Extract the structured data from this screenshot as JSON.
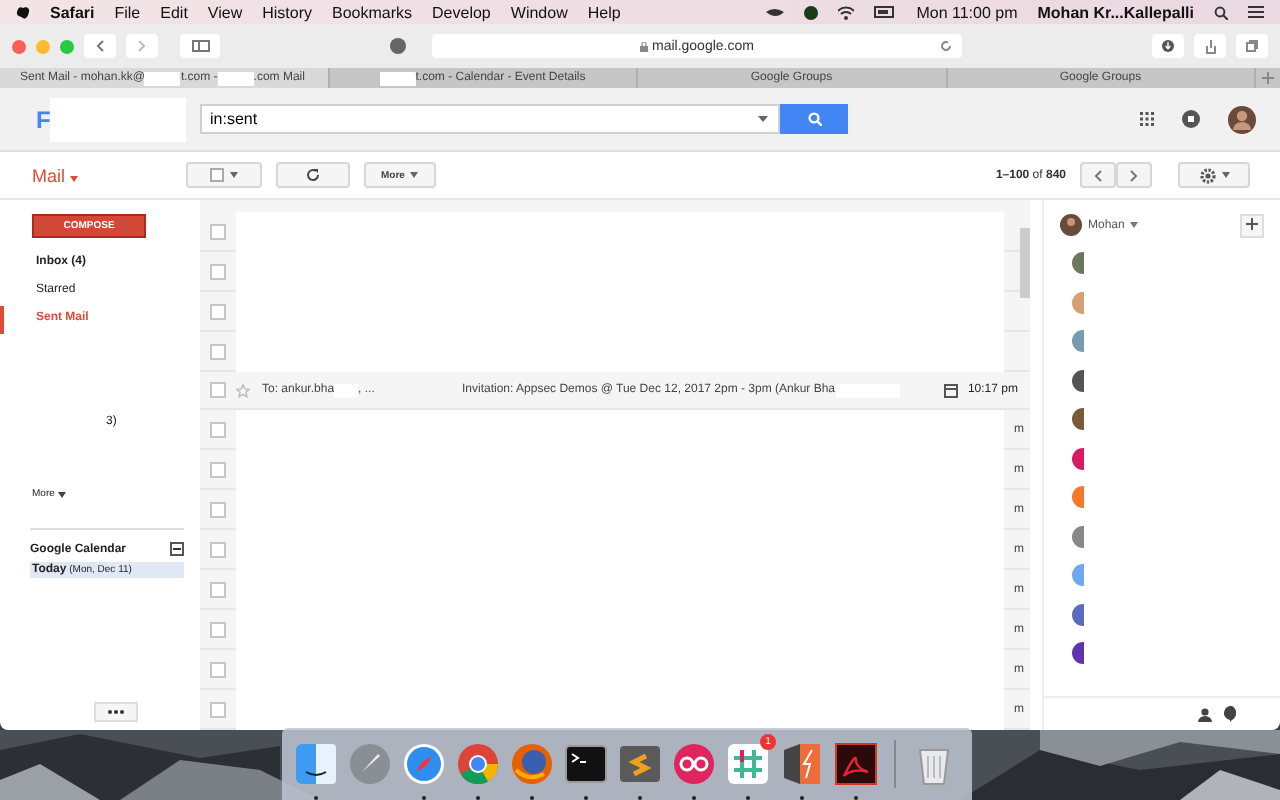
{
  "menubar": {
    "app": "Safari",
    "menus": [
      "File",
      "Edit",
      "View",
      "History",
      "Bookmarks",
      "Develop",
      "Window",
      "Help"
    ],
    "clock": "Mon 11:00 pm",
    "user": "Mohan Kr...Kallepalli"
  },
  "browser": {
    "address": "mail.google.com",
    "tabs": [
      {
        "selected": true,
        "segments": [
          {
            "kind": "text",
            "text": "Sent Mail - mohan.kk@"
          },
          {
            "kind": "redacted"
          },
          {
            "kind": "text",
            "text": "t.com -"
          },
          {
            "kind": "redacted"
          },
          {
            "kind": "text",
            "text": ".com Mail"
          }
        ]
      },
      {
        "selected": false,
        "segments": [
          {
            "kind": "redacted"
          },
          {
            "kind": "text",
            "text": "t.com - Calendar - Event Details"
          }
        ]
      },
      {
        "selected": false,
        "segments": [
          {
            "kind": "text",
            "text": "Google Groups"
          }
        ]
      },
      {
        "selected": false,
        "segments": [
          {
            "kind": "text",
            "text": "Google Groups"
          }
        ]
      }
    ]
  },
  "gmail": {
    "logo_letter": "F",
    "search": {
      "value": "in:sent"
    },
    "mail_label": "Mail",
    "more_button": "More",
    "pager": "**1–100** of **840**"
  },
  "sidebar": {
    "compose": "COMPOSE",
    "items": [
      {
        "label": "Inbox (4)",
        "bold": true,
        "selected": false
      },
      {
        "label": "Starred",
        "bold": false,
        "selected": false
      },
      {
        "label": "Sent Mail",
        "bold": true,
        "selected": true
      }
    ],
    "fragment": "3)",
    "more": "More",
    "calendar": {
      "title": "Google Calendar",
      "expanded": true,
      "today": "Today",
      "date": "(Mon, Dec 11)"
    }
  },
  "rows": [
    {
      "kind": "redacted",
      "checked": false
    },
    {
      "kind": "redacted",
      "checked": false
    },
    {
      "kind": "redacted",
      "checked": false
    },
    {
      "kind": "redacted",
      "checked": false
    },
    {
      "kind": "mail",
      "checked": false,
      "to": "To: ankur.bha",
      "to_tail": ", ...",
      "subject": "Invitation: Appsec Demos @ Tue Dec 12, 2017 2pm - 3pm (Ankur Bha",
      "time": "10:17 pm"
    },
    {
      "kind": "redacted",
      "checked": false,
      "time": "m"
    },
    {
      "kind": "redacted",
      "checked": false,
      "time": "m"
    },
    {
      "kind": "redacted",
      "checked": false,
      "time": "m"
    },
    {
      "kind": "redacted",
      "checked": false,
      "time": "m"
    },
    {
      "kind": "redacted",
      "checked": false,
      "time": "m"
    },
    {
      "kind": "redacted",
      "checked": false,
      "time": "m"
    },
    {
      "kind": "redacted",
      "checked": false,
      "time": "m"
    },
    {
      "kind": "redacted",
      "checked": false,
      "time": "m"
    }
  ],
  "contacts": {
    "name": "Mohan",
    "people": [
      {
        "color": "#6b7a5c"
      },
      {
        "color": "#d8a070"
      },
      {
        "color": "#7a9ab0"
      },
      {
        "color": "#555555"
      },
      {
        "color": "#7a5a3a"
      },
      {
        "color": "#d81b60"
      },
      {
        "color": "#f4792a"
      },
      {
        "color": "#888888"
      },
      {
        "color": "#6fa8f0"
      },
      {
        "color": "#5c6bc0"
      },
      {
        "color": "#5e35b1"
      }
    ]
  },
  "dock": [
    {
      "kind": "finder",
      "running": true
    },
    {
      "kind": "rocket",
      "running": false
    },
    {
      "kind": "compass",
      "running": true
    },
    {
      "kind": "ring",
      "running": true
    },
    {
      "kind": "globe",
      "running": true
    },
    {
      "kind": "terminal",
      "running": true
    },
    {
      "kind": "zigzag",
      "running": true
    },
    {
      "kind": "dots",
      "running": true
    },
    {
      "kind": "hash",
      "running": true,
      "badge": "1"
    },
    {
      "kind": "bolt",
      "running": true
    },
    {
      "kind": "curve",
      "running": true
    },
    {
      "kind": "trash",
      "running": false
    }
  ]
}
